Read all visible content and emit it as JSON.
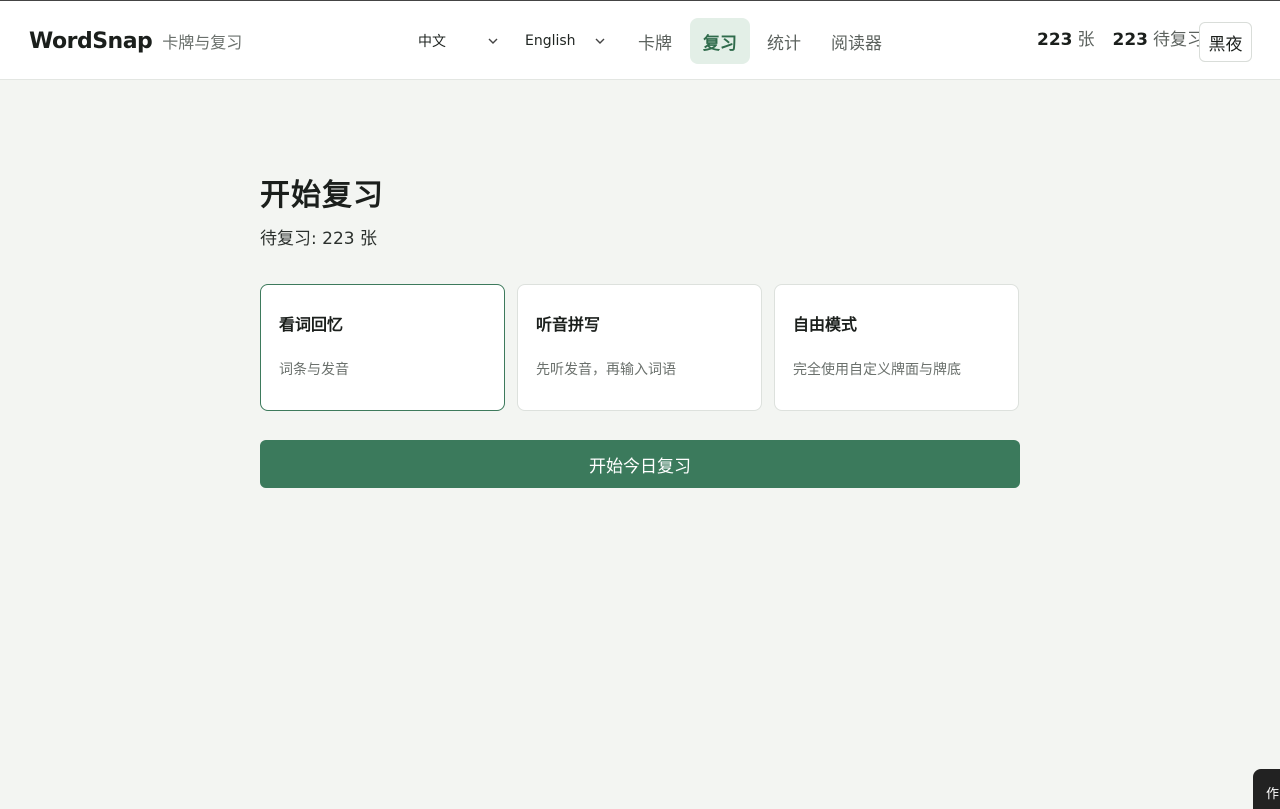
{
  "brand": {
    "name": "WordSnap",
    "subtitle": "卡牌与复习"
  },
  "languages": {
    "source": "中文",
    "target": "English"
  },
  "nav": {
    "items": [
      {
        "label": "卡牌"
      },
      {
        "label": "复习",
        "active": true
      },
      {
        "label": "统计"
      },
      {
        "label": "阅读器"
      }
    ]
  },
  "stats": {
    "cards_count": "223",
    "cards_label": "张",
    "due_count": "223",
    "due_label": "待复习"
  },
  "theme": {
    "night_label": "黑夜"
  },
  "main": {
    "title": "开始复习",
    "due_text": "待复习: 223 张",
    "modes": [
      {
        "title": "看词回忆",
        "desc": "词条与发音",
        "selected": true
      },
      {
        "title": "听音拼写",
        "desc": "先听发音，再输入词语"
      },
      {
        "title": "自由模式",
        "desc": "完全使用自定义牌面与牌底"
      }
    ],
    "start_label": "开始今日复习"
  },
  "corner": {
    "label": "作"
  },
  "colors": {
    "accent": "#3b7a5c",
    "active_bg": "#e3efe7",
    "page_bg": "#f3f5f2"
  }
}
